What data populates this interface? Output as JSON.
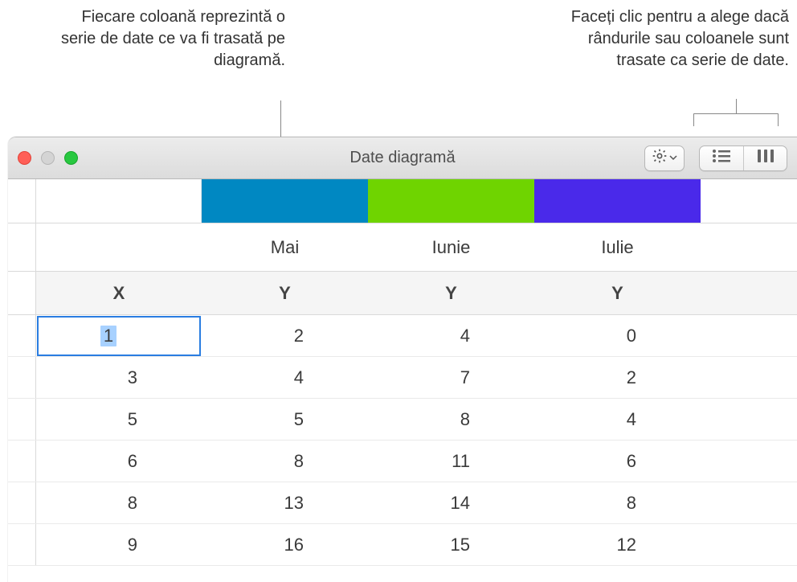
{
  "callouts": {
    "left": "Fiecare coloană reprezintă o serie de date ce va fi trasată pe diagramă.",
    "right": "Faceți clic pentru a alege dacă rândurile sau coloanele sunt trasate ca serie de date."
  },
  "window": {
    "title": "Date diagramă"
  },
  "series_colors": {
    "col1": "#0088c2",
    "col2": "#6fd400",
    "col3": "#4a29ea"
  },
  "column_names": {
    "c1": "Mai",
    "c2": "Iunie",
    "c3": "Iulie"
  },
  "axis_labels": {
    "x": "X",
    "y": "Y"
  },
  "rows": [
    {
      "x": "1",
      "c1": "2",
      "c2": "4",
      "c3": "0"
    },
    {
      "x": "3",
      "c1": "4",
      "c2": "7",
      "c3": "2"
    },
    {
      "x": "5",
      "c1": "5",
      "c2": "8",
      "c3": "4"
    },
    {
      "x": "6",
      "c1": "8",
      "c2": "11",
      "c3": "6"
    },
    {
      "x": "8",
      "c1": "13",
      "c2": "14",
      "c3": "8"
    },
    {
      "x": "9",
      "c1": "16",
      "c2": "15",
      "c3": "12"
    }
  ],
  "selected_cell_value": "1"
}
